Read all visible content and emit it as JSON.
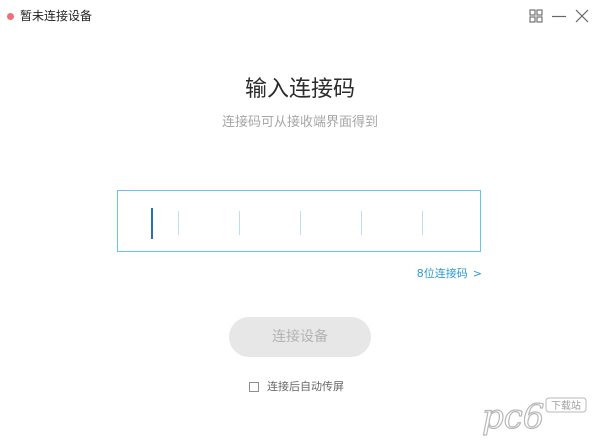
{
  "titlebar": {
    "title": "暂未连接设备",
    "status_color": "#f0707a",
    "buttons": [
      "layout-icon",
      "minimize-icon",
      "close-icon"
    ]
  },
  "main": {
    "heading": "输入连接码",
    "subheading": "连接码可从接收端界面得到",
    "code_input": {
      "value": "",
      "slots": 6,
      "border_color": "#6cc3e8"
    },
    "code_mode_link": "8位连接码",
    "code_mode_arrow": ">",
    "connect_button": "连接设备",
    "auto_cast": {
      "label": "连接后自动传屏",
      "checked": false
    }
  },
  "watermark": {
    "brand": "pc6",
    "tag": "下载站"
  },
  "colors": {
    "accent": "#2f9ad3",
    "cursor": "#2a6fb5",
    "button_disabled_bg": "#e7e7e7"
  }
}
